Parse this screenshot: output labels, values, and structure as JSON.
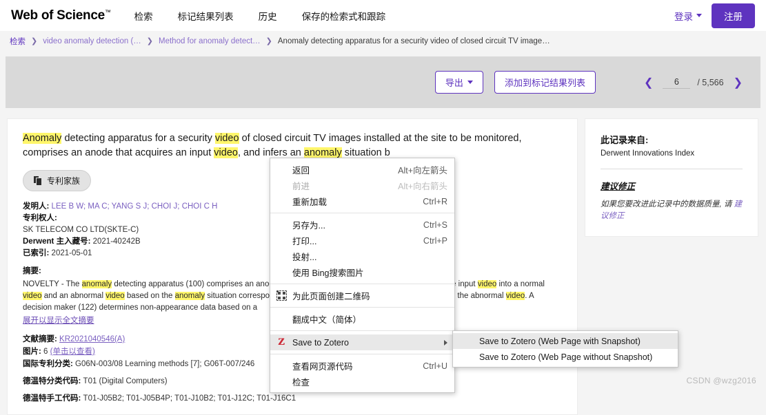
{
  "header": {
    "brand": "Web of Science",
    "brand_tm": "™",
    "nav": [
      {
        "label": "检索"
      },
      {
        "label": "标记结果列表"
      },
      {
        "label": "历史"
      },
      {
        "label": "保存的检索式和跟踪"
      }
    ],
    "signin": "登录",
    "register": "注册"
  },
  "breadcrumb": {
    "items": [
      {
        "label": "检索",
        "type": "link-first"
      },
      {
        "label": "video anomaly detection (…",
        "type": "link"
      },
      {
        "label": "Method for anomaly detect…",
        "type": "link"
      },
      {
        "label": "Anomaly detecting apparatus for a security video of closed circuit TV image…",
        "type": "current"
      }
    ],
    "separator": "❯"
  },
  "actionbar": {
    "export_label": "导出",
    "add_to_marked_label": "添加到标记结果列表",
    "prev_arrow": "❮",
    "next_arrow": "❯",
    "page_value": "6",
    "page_total": "/ 5,566"
  },
  "record": {
    "title_parts": [
      {
        "t": "Anomaly",
        "hl": true
      },
      {
        "t": " detecting apparatus for a security ",
        "hl": false
      },
      {
        "t": "video",
        "hl": true
      },
      {
        "t": " of closed circuit TV images installed at the site to be monitored, comprises an anode that acquires an input ",
        "hl": false
      },
      {
        "t": "video",
        "hl": true
      },
      {
        "t": ", and infers an ",
        "hl": false
      },
      {
        "t": "anomaly",
        "hl": true
      },
      {
        "t": " situation b",
        "hl": false
      }
    ],
    "patent_family_btn": "专利家族",
    "inventors_label": "发明人:",
    "inventors_value": "LEE B W; MA C; YANG S J; CHOI J; CHOI C H",
    "assignee_label": "专利权人:",
    "assignee_value": "SK TELECOM CO LTD(SKTE-C)",
    "derwent_accession_label": "Derwent 主入藏号:",
    "derwent_accession_value": "2021-40242B",
    "indexed_label": "已索引:",
    "indexed_value": "2021-05-01",
    "abstract_label": "摘要:",
    "abstract_parts": [
      {
        "t": "NOVELTY - The ",
        "hl": false
      },
      {
        "t": "anomaly",
        "hl": true
      },
      {
        "t": " detecting apparatus (100) comprises an anode that acquires an input ",
        "hl": false
      },
      {
        "t": "video",
        "hl": true
      },
      {
        "t": ", and distinguishes the input ",
        "hl": false
      },
      {
        "t": "video",
        "hl": true
      },
      {
        "t": " into a normal ",
        "hl": false
      },
      {
        "t": "video",
        "hl": true
      },
      {
        "t": " and an abnormal ",
        "hl": false
      },
      {
        "t": "video",
        "hl": true
      },
      {
        "t": " based on the ",
        "hl": false
      },
      {
        "t": "anomaly",
        "hl": true
      },
      {
        "t": " situation corresponding to predefined appearance categories based on the abnormal ",
        "hl": false
      },
      {
        "t": "video",
        "hl": true
      },
      {
        "t": ". A decision maker (122) determines non-appearance data based on a",
        "hl": false
      }
    ],
    "expand_link": "展开以显示全文摘要",
    "patent_abstract_label": "文献摘要:",
    "patent_abstract_value": "KR2021040546(A)",
    "images_label": "图片:",
    "images_count": "6",
    "images_link": "(单击以查看)",
    "ipc_label": "国际专利分类:",
    "ipc_value": "G06N-003/08 Learning methods [7]; G06T-007/246",
    "derwent_class_label": "德温特分类代码:",
    "derwent_class_value": "T01 (Digital Computers)",
    "derwent_manual_label": "德温特手工代码:",
    "derwent_manual_value": "T01-J05B2; T01-J05B4P; T01-J10B2; T01-J12C; T01-J16C1"
  },
  "sidecard": {
    "source_label": "此记录来自:",
    "source_value": "Derwent Innovations Index",
    "suggest_title": "建议修正",
    "suggest_body_pre": "如果您要改进此记录中的数据质量, 请 ",
    "suggest_body_link": "建议修正"
  },
  "context_menu": {
    "items": [
      {
        "label": "返回",
        "accel": "Alt+向左箭头",
        "disabled": false,
        "icon": "",
        "sep_after": false
      },
      {
        "label": "前进",
        "accel": "Alt+向右箭头",
        "disabled": true,
        "icon": "",
        "sep_after": false
      },
      {
        "label": "重新加载",
        "accel": "Ctrl+R",
        "disabled": false,
        "icon": "",
        "sep_after": true
      },
      {
        "label": "另存为...",
        "accel": "Ctrl+S",
        "disabled": false,
        "icon": "",
        "sep_after": false
      },
      {
        "label": "打印...",
        "accel": "Ctrl+P",
        "disabled": false,
        "icon": "",
        "sep_after": false
      },
      {
        "label": "投射...",
        "accel": "",
        "disabled": false,
        "icon": "",
        "sep_after": false
      },
      {
        "label": "使用 Bing搜索图片",
        "accel": "",
        "disabled": false,
        "icon": "",
        "sep_after": true
      },
      {
        "label": "为此页面创建二维码",
        "accel": "",
        "disabled": false,
        "icon": "qr-code-icon",
        "sep_after": true
      },
      {
        "label": "翻成中文（简体）",
        "accel": "",
        "disabled": false,
        "icon": "",
        "sep_after": true
      },
      {
        "label": "Save to Zotero",
        "accel": "",
        "disabled": false,
        "icon": "zotero-icon",
        "submenu": true,
        "highlight": true,
        "sep_after": true
      },
      {
        "label": "查看网页源代码",
        "accel": "Ctrl+U",
        "disabled": false,
        "icon": "",
        "sep_after": false
      },
      {
        "label": "检查",
        "accel": "",
        "disabled": false,
        "icon": "",
        "sep_after": false
      }
    ]
  },
  "submenu": {
    "items": [
      {
        "label": "Save to Zotero (Web Page with Snapshot)",
        "highlight": true
      },
      {
        "label": "Save to Zotero (Web Page without Snapshot)",
        "highlight": false
      }
    ]
  },
  "watermark": "CSDN @wzg2016",
  "colors": {
    "brand_purple": "#5E33BF",
    "highlight_yellow": "#fff66b",
    "band_gray": "#d9d9d9",
    "zotero_red": "#CC2936"
  }
}
